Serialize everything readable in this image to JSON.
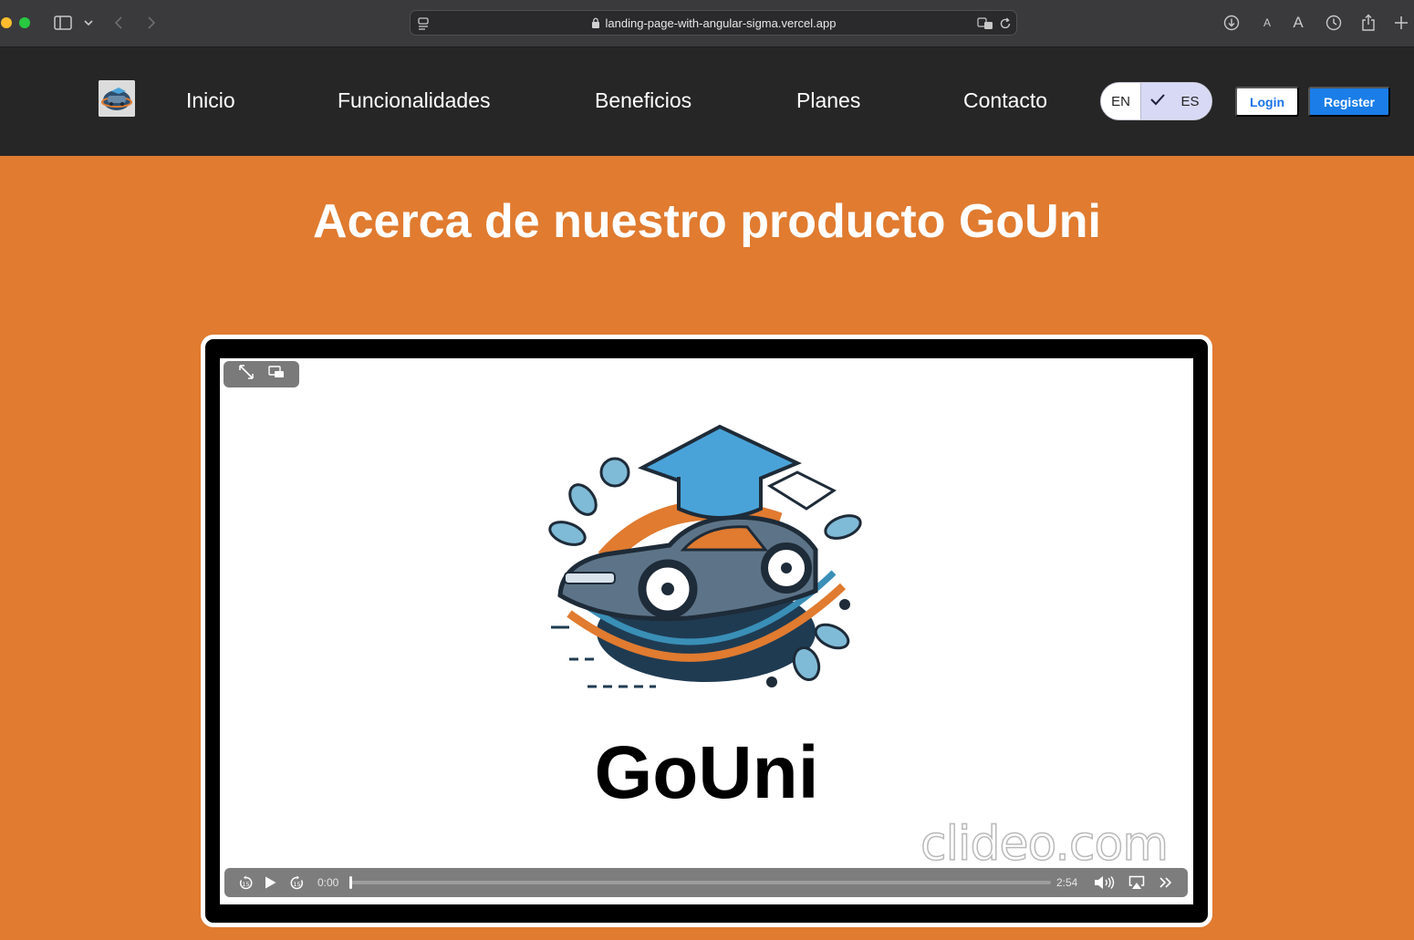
{
  "browser": {
    "url": "landing-page-with-angular-sigma.vercel.app"
  },
  "nav": {
    "links": [
      "Inicio",
      "Funcionalidades",
      "Beneficios",
      "Planes",
      "Contacto"
    ],
    "lang_en": "EN",
    "lang_es": "ES",
    "login_label": "Login",
    "register_label": "Register"
  },
  "hero": {
    "title": "Acerca de nuestro producto GoUni"
  },
  "video": {
    "brand_text": "GoUni",
    "watermark": "clideo.com",
    "current_time": "0:00",
    "duration": "2:54",
    "progress": 0
  },
  "colors": {
    "page_bg": "#e07b30",
    "nav_bg": "#262626",
    "register_bg": "#1a7de8",
    "login_text": "#1a73e8"
  }
}
